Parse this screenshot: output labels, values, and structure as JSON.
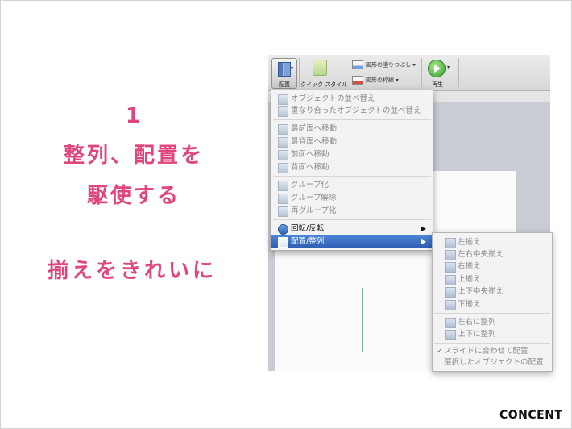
{
  "left_text": {
    "number": "1",
    "line1": "整列、配置を",
    "line2": "駆使する",
    "line3": "揃えをきれいに"
  },
  "brand": "CONCENT",
  "ribbon": {
    "arrange_label": "配置",
    "quick_style_label": "クイック スタイル",
    "fill_label": "図形の塗りつぶし",
    "outline_label": "図形の枠線",
    "play_label": "再生"
  },
  "menu": {
    "items": [
      {
        "label": "オブジェクトの並べ替え",
        "enabled": false
      },
      {
        "label": "重なり合ったオブジェクトの並べ替え",
        "enabled": false
      },
      {
        "label": "最前面へ移動",
        "enabled": false
      },
      {
        "label": "最背面へ移動",
        "enabled": false
      },
      {
        "label": "前面へ移動",
        "enabled": false
      },
      {
        "label": "背面へ移動",
        "enabled": false
      },
      {
        "label": "グループ化",
        "enabled": false
      },
      {
        "label": "グループ解除",
        "enabled": false
      },
      {
        "label": "再グループ化",
        "enabled": false
      },
      {
        "label": "回転/反転",
        "enabled": true,
        "submenu_arrow": "▶"
      },
      {
        "label": "配置/整列",
        "enabled": true,
        "highlighted": true,
        "submenu_arrow": "▶"
      }
    ]
  },
  "submenu": {
    "items": [
      {
        "label": "左揃え"
      },
      {
        "label": "左右中央揃え"
      },
      {
        "label": "右揃え"
      },
      {
        "label": "上揃え"
      },
      {
        "label": "上下中央揃え"
      },
      {
        "label": "下揃え"
      },
      {
        "label": "左右に整列"
      },
      {
        "label": "上下に整列"
      },
      {
        "label": "スライドに合わせて配置",
        "checked": true,
        "check_mark": "✓"
      },
      {
        "label": "選択したオブジェクトの配置"
      }
    ]
  },
  "colors": {
    "accent_pink": "#e0457e",
    "menu_highlight": "#3a6fc4"
  }
}
